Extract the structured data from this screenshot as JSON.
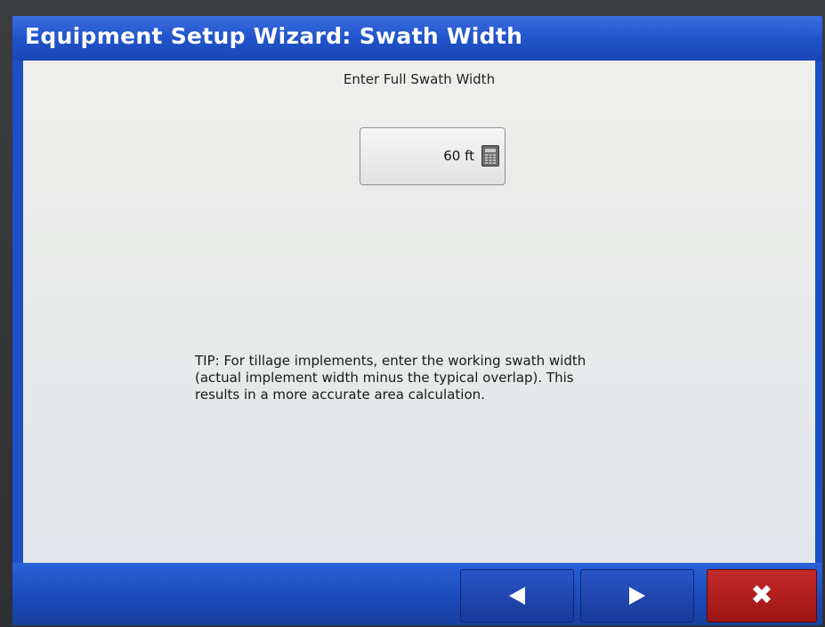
{
  "title_bar": {
    "title": "Equipment Setup Wizard:  Swath Width"
  },
  "main": {
    "prompt": "Enter Full Swath Width",
    "swath_width": {
      "value": "60 ft",
      "icon": "calculator-icon"
    },
    "tip_lines": [
      "TIP:  For tillage implements, enter the working swath width",
      "(actual implement width minus the typical overlap).  This",
      "results in a more accurate area calculation."
    ]
  },
  "footer": {
    "back_icon": "arrow-left-icon",
    "next_icon": "arrow-right-icon",
    "cancel_glyph": "✖"
  },
  "colors": {
    "title_blue": "#1f52c8",
    "cancel_red": "#b01c1c",
    "content_bg": "#ececea"
  }
}
